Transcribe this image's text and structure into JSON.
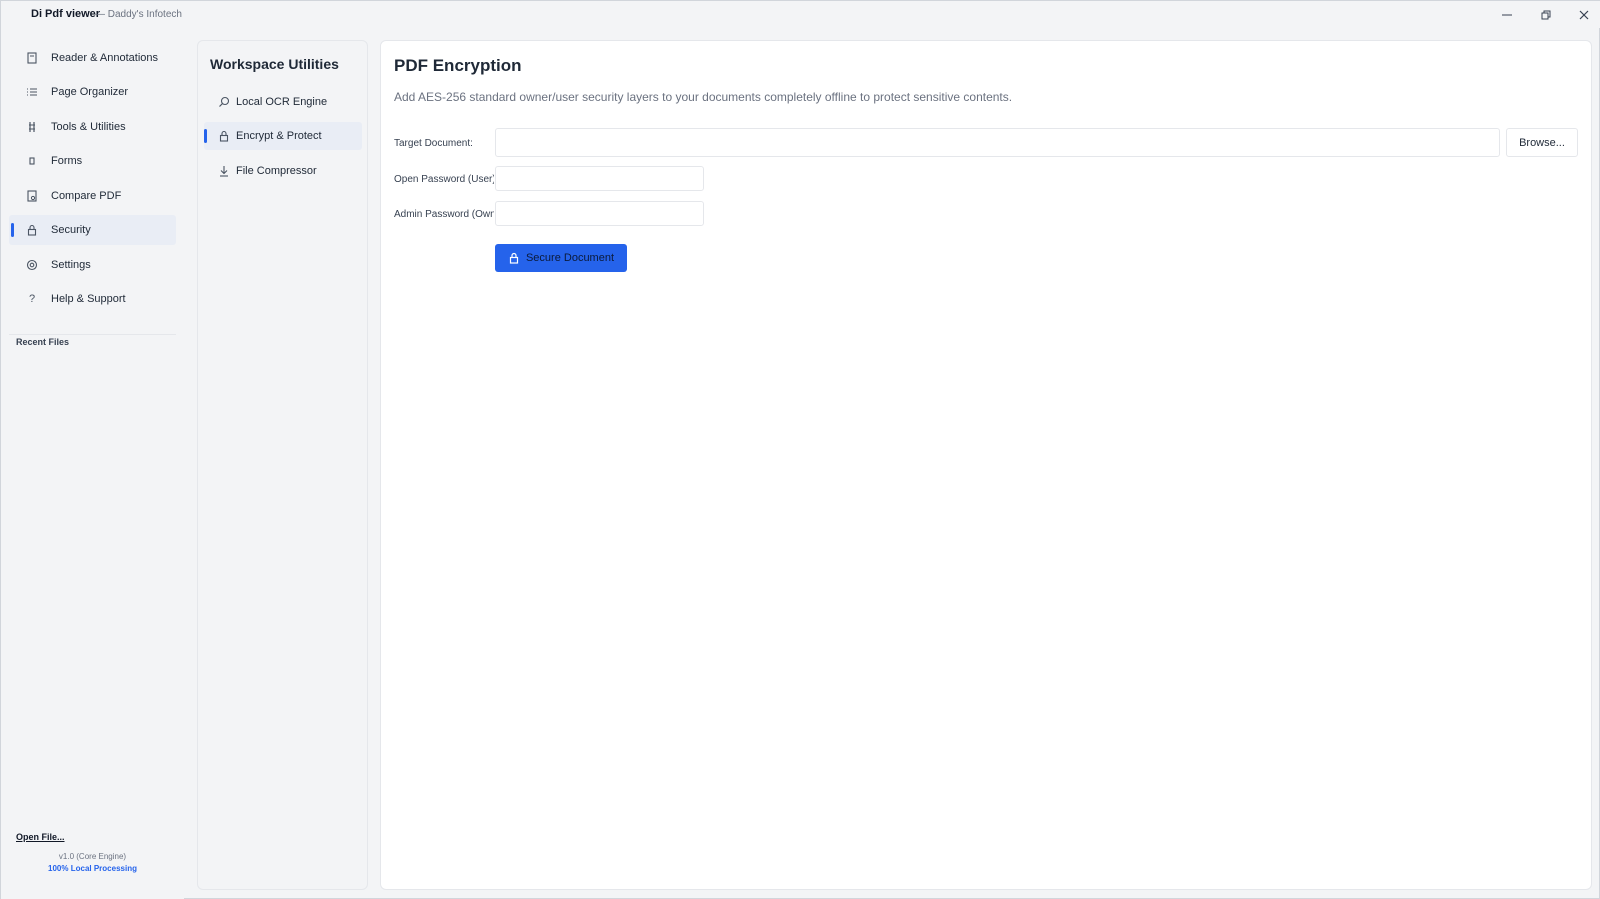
{
  "app": {
    "title": "Di Pdf viewer",
    "subtitle": "— Daddy's Infotech"
  },
  "sidebar": {
    "items": [
      {
        "label": "Reader & Annotations",
        "icon": "book-icon"
      },
      {
        "label": "Page Organizer",
        "icon": "list-icon"
      },
      {
        "label": "Tools & Utilities",
        "icon": "tools-icon"
      },
      {
        "label": "Forms",
        "icon": "form-icon"
      },
      {
        "label": "Compare PDF",
        "icon": "compare-icon"
      },
      {
        "label": "Security",
        "icon": "lock-icon",
        "active": true
      },
      {
        "label": "Settings",
        "icon": "gear-icon"
      },
      {
        "label": "Help & Support",
        "icon": "help-icon"
      }
    ],
    "recent_files_title": "Recent Files",
    "open_file_label": "Open File...",
    "version": "v1.0 (Core Engine)",
    "local_processing": "100% Local Processing"
  },
  "workspace": {
    "title": "Workspace Utilities",
    "items": [
      {
        "label": "Local OCR Engine",
        "icon": "search-icon"
      },
      {
        "label": "Encrypt & Protect",
        "icon": "lock-icon",
        "active": true
      },
      {
        "label": "File Compressor",
        "icon": "download-icon"
      }
    ]
  },
  "main": {
    "title": "PDF Encryption",
    "description": "Add AES-256 standard owner/user security layers to your documents completely offline to protect sensitive contents.",
    "target_label": "Target Document:",
    "target_value": "",
    "browse_label": "Browse...",
    "open_password_label": "Open Password (User):",
    "open_password_value": "",
    "admin_password_label": "Admin Password (Owner):",
    "admin_password_value": "",
    "secure_label": "Secure Document"
  },
  "colors": {
    "accent": "#2563eb",
    "background": "#f3f4f6",
    "panel": "#ffffff"
  }
}
